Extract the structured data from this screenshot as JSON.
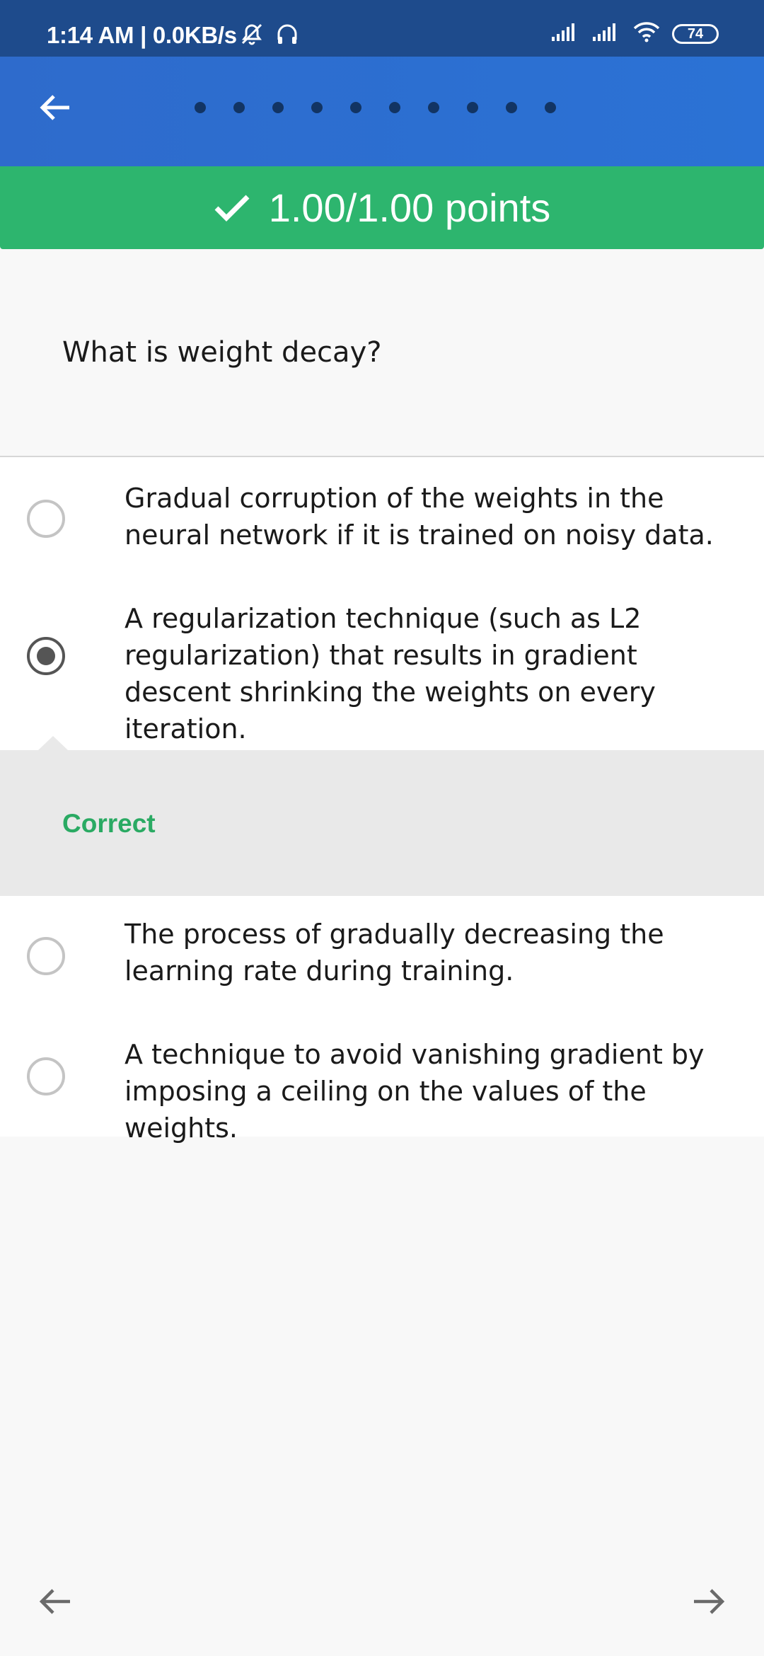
{
  "status_bar": {
    "time_network": "1:14 AM | 0.0KB/s",
    "battery": "74",
    "icons": [
      "alarm-off-icon",
      "headphones-icon",
      "signal-icon",
      "signal-icon",
      "wifi-icon",
      "battery-icon"
    ]
  },
  "app_bar": {
    "back_icon": "arrow-left-icon",
    "progress_dot_count": 10
  },
  "score": {
    "icon": "check-icon",
    "text": "1.00/1.00 points",
    "color": "#2db56e"
  },
  "question": {
    "text": "What is weight decay?"
  },
  "options": [
    {
      "text": "Gradual corruption of the weights in the neural network if it is trained on noisy data.",
      "selected": false
    },
    {
      "text": "A regularization technique (such as L2 regularization) that results in gradient descent shrinking the weights on every iteration.",
      "selected": true
    },
    {
      "text": "The process of gradually decreasing the learning rate during training.",
      "selected": false
    },
    {
      "text": "A technique to avoid vanishing gradient by imposing a ceiling on the values of the weights.",
      "selected": false
    }
  ],
  "feedback": {
    "label": "Correct",
    "color": "#2aaa63"
  },
  "bottom_nav": {
    "prev_icon": "arrow-left-icon",
    "next_icon": "arrow-right-icon"
  }
}
